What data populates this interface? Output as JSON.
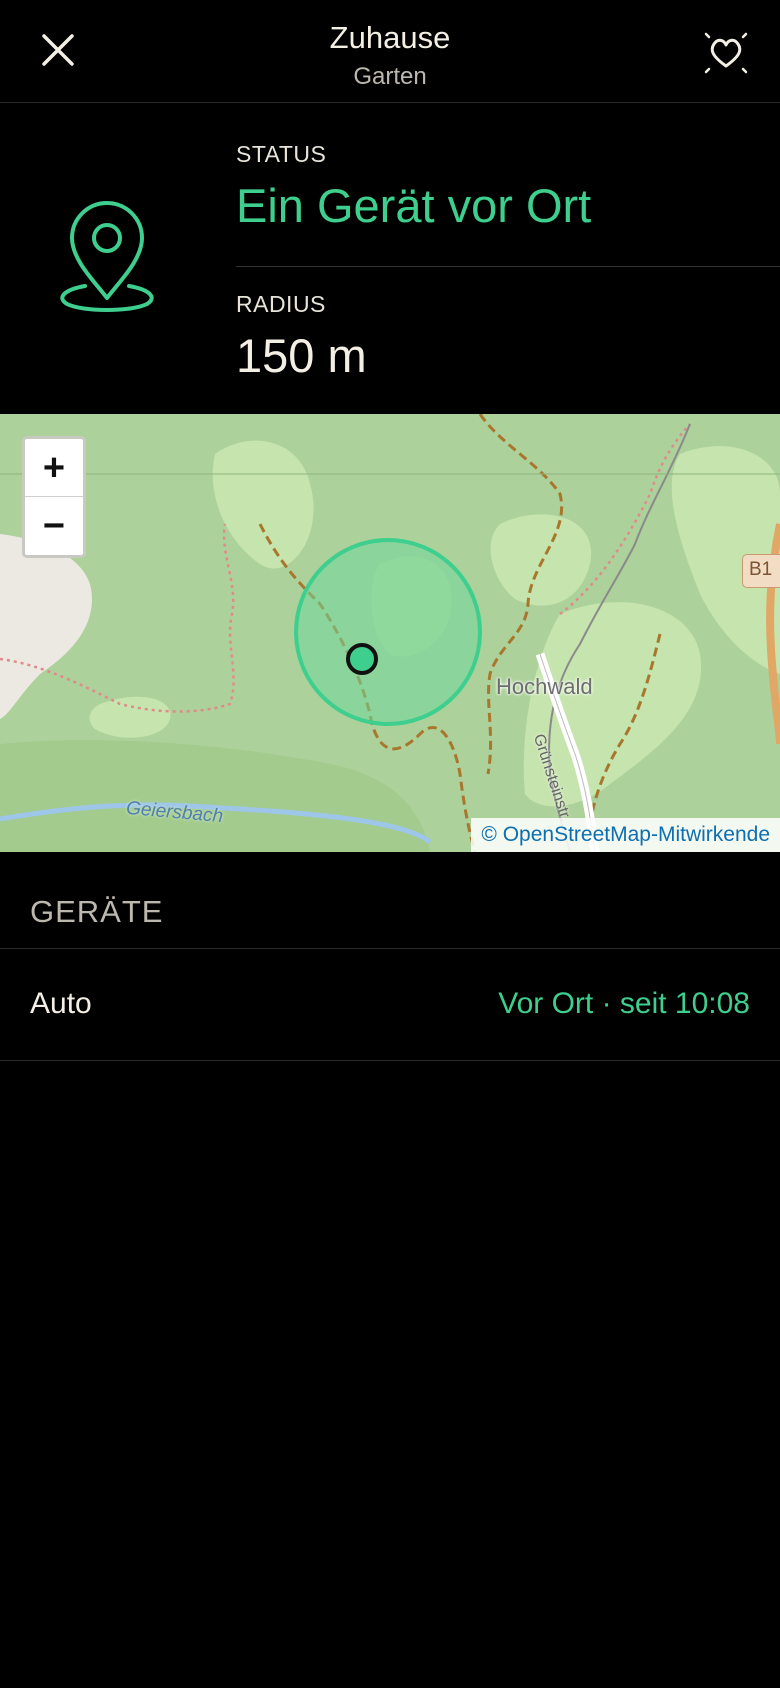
{
  "header": {
    "title": "Zuhause",
    "subtitle": "Garten",
    "close_icon": "close-icon",
    "favorite_icon": "heart-sparkle-icon"
  },
  "info": {
    "icon": "location-pin-icon",
    "status_label": "STATUS",
    "status_value": "Ein Gerät vor Ort",
    "radius_label": "RADIUS",
    "radius_value": "150 m"
  },
  "map": {
    "zoom_in_label": "+",
    "zoom_out_label": "−",
    "attribution": "© OpenStreetMap-Mitwirkende",
    "place_labels": {
      "hochwald": "Hochwald",
      "geiersbach": "Geiersbach",
      "road": "B1",
      "street": "Grünsteinstr."
    }
  },
  "devices": {
    "title": "GERÄTE",
    "items": [
      {
        "name": "Auto",
        "status": "Vor Ort · seit 10:08"
      }
    ]
  },
  "colors": {
    "accent": "#3ecf8e",
    "background": "#000000",
    "text": "#f4efe5",
    "muted": "#bdb8af"
  }
}
